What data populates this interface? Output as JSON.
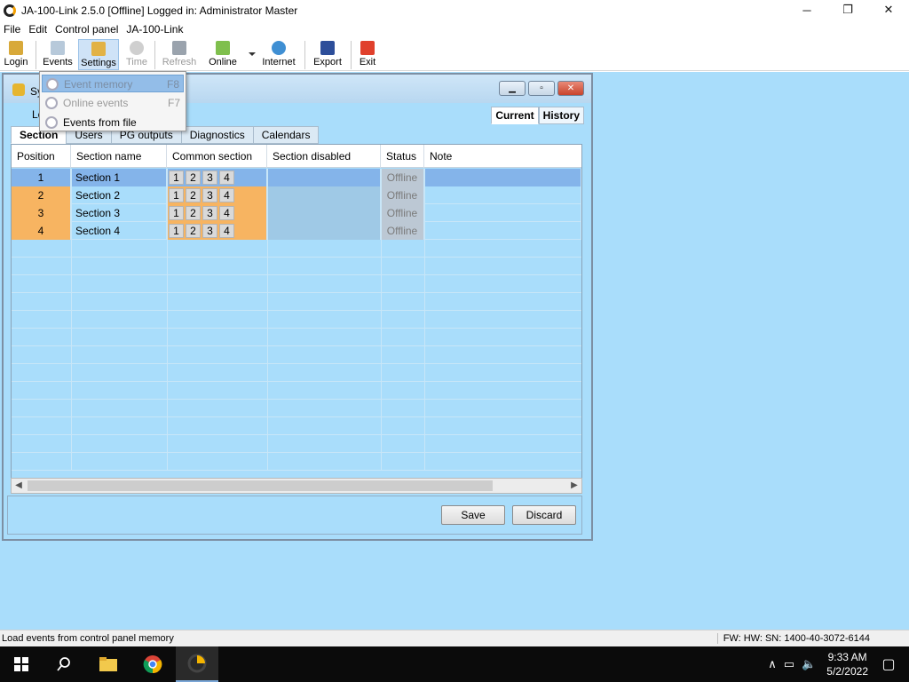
{
  "window": {
    "title": "JA-100-Link 2.5.0 [Offline] Logged in: Administrator Master",
    "controls": {
      "minimize": "─",
      "maximize": "❐",
      "close": "✕"
    }
  },
  "menubar": {
    "items": [
      {
        "label": "File"
      },
      {
        "label": "Edit"
      },
      {
        "label": "Control panel"
      },
      {
        "label": "JA-100-Link"
      }
    ]
  },
  "toolbar": {
    "login": "Login",
    "events": "Events",
    "settings": "Settings",
    "time": "Time",
    "refresh": "Refresh",
    "online": "Online",
    "internet": "Internet",
    "export": "Export",
    "exit": "Exit"
  },
  "dropdown": {
    "items": [
      {
        "label": "Event memory",
        "key": "F8",
        "state": "highlighted"
      },
      {
        "label": "Online events",
        "key": "F7",
        "state": "disabled"
      },
      {
        "label": "Events from file",
        "key": "",
        "state": "enabled"
      }
    ]
  },
  "child_window": {
    "title": "Sy",
    "lo_label": "Lo",
    "mode_tabs": [
      {
        "label": "Current"
      },
      {
        "label": "History"
      }
    ],
    "tabs": [
      {
        "label": "Section"
      },
      {
        "label": "Users"
      },
      {
        "label": "PG outputs"
      },
      {
        "label": "Diagnostics"
      },
      {
        "label": "Calendars"
      }
    ]
  },
  "grid": {
    "columns": [
      "Position",
      "Section name",
      "Common section",
      "Section disabled",
      "Status",
      "Note"
    ],
    "rows": [
      {
        "position": "1",
        "name": "Section 1",
        "common": [
          "1",
          "2",
          "3",
          "4"
        ],
        "status": "Offline"
      },
      {
        "position": "2",
        "name": "Section 2",
        "common": [
          "1",
          "2",
          "3",
          "4"
        ],
        "status": "Offline"
      },
      {
        "position": "3",
        "name": "Section 3",
        "common": [
          "1",
          "2",
          "3",
          "4"
        ],
        "status": "Offline"
      },
      {
        "position": "4",
        "name": "Section 4",
        "common": [
          "1",
          "2",
          "3",
          "4"
        ],
        "status": "Offline"
      }
    ]
  },
  "buttons": {
    "save": "Save",
    "discard": "Discard"
  },
  "statusbar": {
    "left": "Load events from control panel memory",
    "right": "FW:  HW:  SN: 1400-40-3072-6144"
  },
  "taskbar": {
    "time": "9:33 AM",
    "date": "5/2/2022"
  },
  "colors": {
    "workspace": "#a9ddfb",
    "orange": "#f7b461",
    "selected_row": "#84b4ea"
  }
}
